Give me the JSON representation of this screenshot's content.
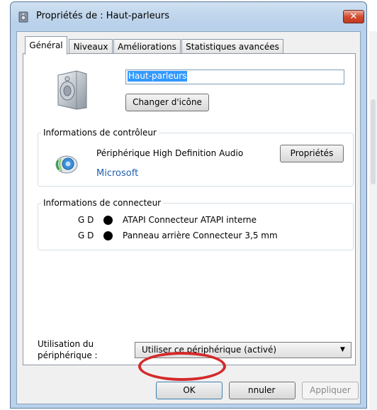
{
  "window": {
    "title": "Propriétés de : Haut-parleurs",
    "close_glyph": "✕"
  },
  "tabs": [
    {
      "label": "Général",
      "active": true
    },
    {
      "label": "Niveaux",
      "active": false
    },
    {
      "label": "Améliorations",
      "active": false
    },
    {
      "label": "Statistiques avancées",
      "active": false
    }
  ],
  "device": {
    "icon": "speaker-icon",
    "name_value": "Haut-parleurs",
    "change_icon_label": "Changer d'icône"
  },
  "controller": {
    "legend": "Informations de contrôleur",
    "icon": "audio-device-icon",
    "name": "Périphérique High Definition Audio",
    "vendor": "Microsoft",
    "properties_label": "Propriétés"
  },
  "connector": {
    "legend": "Informations de connecteur",
    "rows": [
      {
        "channels": "G D",
        "label": "ATAPI Connecteur ATAPI interne"
      },
      {
        "channels": "G D",
        "label": "Panneau arrière Connecteur 3,5 mm"
      }
    ]
  },
  "usage": {
    "label_line1": "Utilisation du",
    "label_line2": "périphérique :",
    "selected": "Utiliser ce périphérique (activé)",
    "arrow": "▼"
  },
  "footer": {
    "ok_label": "OK",
    "cancel_label": "Annuler",
    "cancel_visible_part": "nnuler",
    "apply_label": "Appliquer"
  },
  "colors": {
    "link": "#1f5fb0",
    "highlight": "#d42a2a",
    "selection": "#3399ff"
  }
}
